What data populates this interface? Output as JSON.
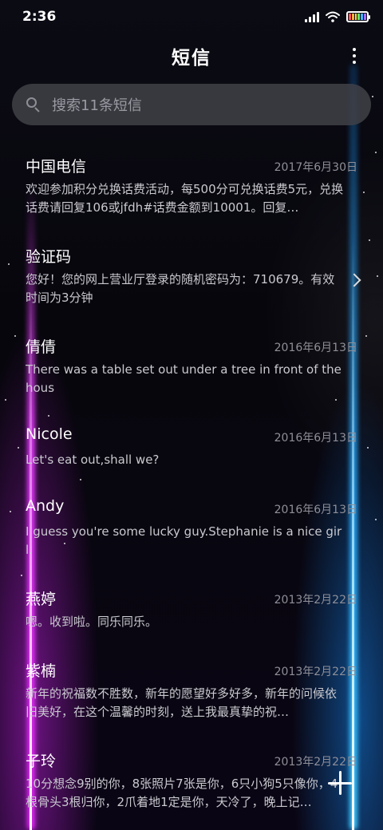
{
  "status_bar": {
    "time": "2:36",
    "icons": [
      "signal-icon",
      "wifi-icon",
      "battery-icon"
    ],
    "battery_colors": [
      "#ff5a5a",
      "#ffb23d",
      "#f5e04a",
      "#6de36a",
      "#3fb6ff",
      "#a56bff"
    ]
  },
  "header": {
    "title": "短信",
    "more_icon": "more-vertical-icon"
  },
  "search": {
    "icon": "search-icon",
    "placeholder": "搜索11条短信"
  },
  "messages": [
    {
      "name": "中国电信",
      "date": "2017年6月30日",
      "preview": "欢迎参加积分兑换话费活动，每500分可兑换话费5元，兑换话费请回复106或jfdh#话费金额到10001。回复…"
    },
    {
      "name": "验证码",
      "date": "",
      "preview": "您好！您的网上营业厅登录的随机密码为：710679。有效时间为3分钟",
      "chevron": "chevron-right-icon"
    },
    {
      "name": "倩倩",
      "date": "2016年6月13日",
      "preview": "There was a table set out under a tree in front of the hous"
    },
    {
      "name": "Nicole",
      "date": "2016年6月13日",
      "preview": "Let's eat out,shall we?"
    },
    {
      "name": "Andy",
      "date": "2016年6月13日",
      "preview": "I guess you're some lucky guy.Stephanie is a nice girl."
    },
    {
      "name": "燕婷",
      "date": "2013年2月22日",
      "preview": "嗯。收到啦。同乐同乐。"
    },
    {
      "name": "紫楠",
      "date": "2013年2月22日",
      "preview": "新年的祝福数不胜数，新年的愿望好多好多，新年的问候依旧美好，在这个温馨的时刻，送上我最真挚的祝…"
    },
    {
      "name": "子玲",
      "date": "2013年2月22日",
      "preview": "10分想念9别的你，8张照片7张是你，6只小狗5只像你，4根骨头3根归你，2爪着地1定是你，天冷了，晚上记…"
    }
  ],
  "fab": {
    "icon": "plus-icon"
  }
}
